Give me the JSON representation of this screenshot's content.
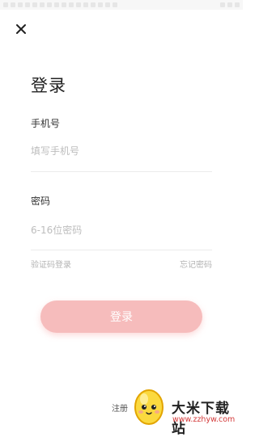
{
  "header": {
    "close_icon": "close-icon"
  },
  "title": "登录",
  "phone": {
    "label": "手机号",
    "placeholder": "填写手机号"
  },
  "password": {
    "label": "密码",
    "placeholder": "6-16位密码"
  },
  "links": {
    "sms_login": "验证码登录",
    "forgot_password": "忘记密码"
  },
  "login_button": "登录",
  "register_link": "注册",
  "watermark": {
    "title": "大米下载站",
    "url": "www.zzhyw.com"
  },
  "colors": {
    "button": "#f6bcbc",
    "link": "#b3b3b3",
    "watermark_url": "#d43b3b"
  }
}
